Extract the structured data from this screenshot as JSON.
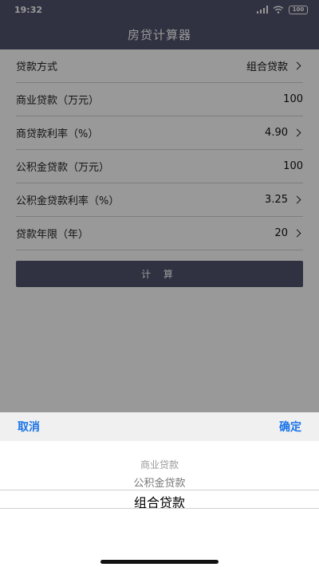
{
  "status_bar": {
    "time": "19:32",
    "battery": "100",
    "icons": [
      "signal-icon",
      "wifi-icon",
      "battery-icon"
    ]
  },
  "header": {
    "title": "房贷计算器"
  },
  "form": {
    "rows": [
      {
        "label": "贷款方式",
        "value": "组合贷款",
        "has_chevron": true
      },
      {
        "label": "商业贷款（万元）",
        "value": "100",
        "has_chevron": false
      },
      {
        "label": "商贷款利率（%）",
        "value": "4.90",
        "has_chevron": true
      },
      {
        "label": "公积金贷款（万元）",
        "value": "100",
        "has_chevron": false
      },
      {
        "label": "公积金贷款利率（%）",
        "value": "3.25",
        "has_chevron": true
      },
      {
        "label": "贷款年限（年）",
        "value": "20",
        "has_chevron": true
      }
    ],
    "calculate_label": "计 算"
  },
  "picker": {
    "cancel_label": "取消",
    "confirm_label": "确定",
    "options": [
      "商业贷款",
      "公积金贷款",
      "组合贷款"
    ],
    "selected": "组合贷款"
  },
  "colors": {
    "header_bg": "#50536d",
    "accent_blue": "#1a73e8"
  }
}
